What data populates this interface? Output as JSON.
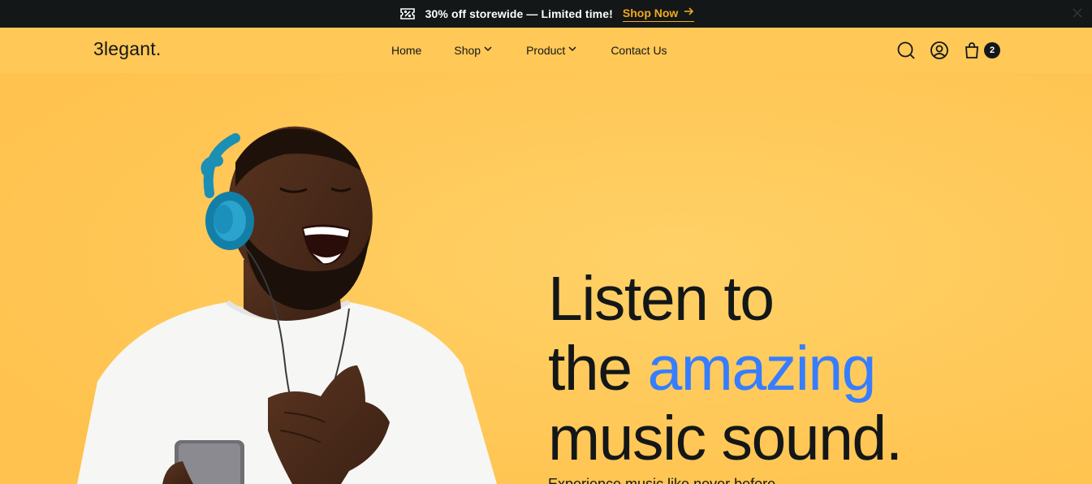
{
  "promo": {
    "icon": "ticket-percent-icon",
    "text": "30% off storewide — Limited time!",
    "link_label": "Shop Now",
    "link_icon": "arrow-right-icon",
    "close_icon": "close-icon",
    "background": "#141718",
    "link_color": "#f0a91f"
  },
  "header": {
    "logo": "3legant.",
    "nav": {
      "home": "Home",
      "shop": "Shop",
      "product": "Product",
      "contact": "Contact Us"
    },
    "cart_count": "2"
  },
  "hero": {
    "headline_line1": "Listen to",
    "headline_line2_a": "the ",
    "headline_line2_b": "amazing",
    "headline_line3": "music sound.",
    "subtext": "Experience music like never before",
    "background": "#ffc857",
    "accent_color": "#377dff",
    "image": "man-with-headphones-image"
  }
}
